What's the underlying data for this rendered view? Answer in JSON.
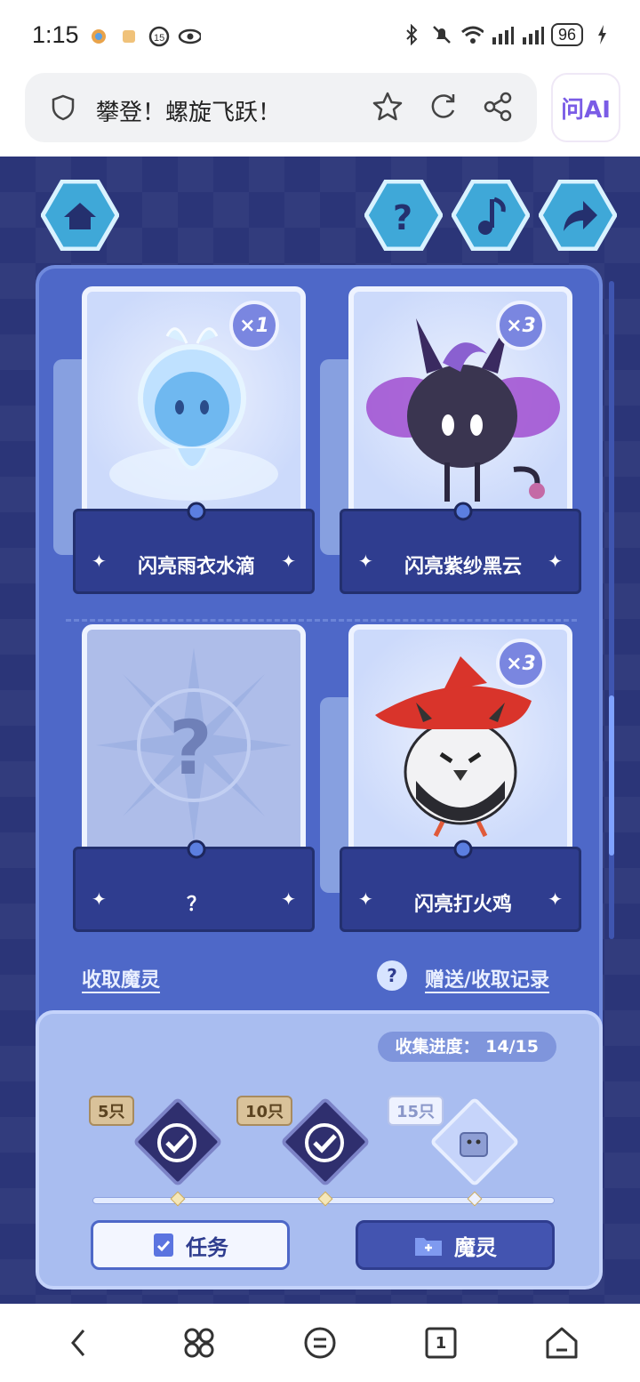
{
  "status_bar": {
    "time": "1:15",
    "battery": "96"
  },
  "browser": {
    "page_title": "攀登！螺旋飞跃！",
    "ai_button_label": "问AI"
  },
  "game": {
    "top_buttons": [
      "home-icon",
      "help-icon",
      "music-icon",
      "share-icon"
    ],
    "cards": [
      {
        "name": "闪亮雨衣水滴",
        "count": "×1",
        "owned": true
      },
      {
        "name": "闪亮紫纱黑云",
        "count": "×3",
        "owned": true
      },
      {
        "name": "？",
        "count": "",
        "owned": false
      },
      {
        "name": "闪亮打火鸡",
        "count": "×3",
        "owned": true
      }
    ],
    "collect_link": "收取魔灵",
    "history_link": "赠送/收取记录",
    "progress_label": "收集进度：",
    "progress_value": "14/15",
    "progress": {
      "current": 14,
      "total": 15
    },
    "milestones": [
      {
        "label": "5只",
        "claimed": true
      },
      {
        "label": "10只",
        "claimed": true
      },
      {
        "label": "15只",
        "claimed": false
      }
    ],
    "tab_task": "任务",
    "tab_spirit": "魔灵"
  },
  "navbar": {
    "items": [
      "back-icon",
      "apps-icon",
      "menu-icon",
      "tabs-icon",
      "home-icon"
    ],
    "tabs_count": "1"
  }
}
